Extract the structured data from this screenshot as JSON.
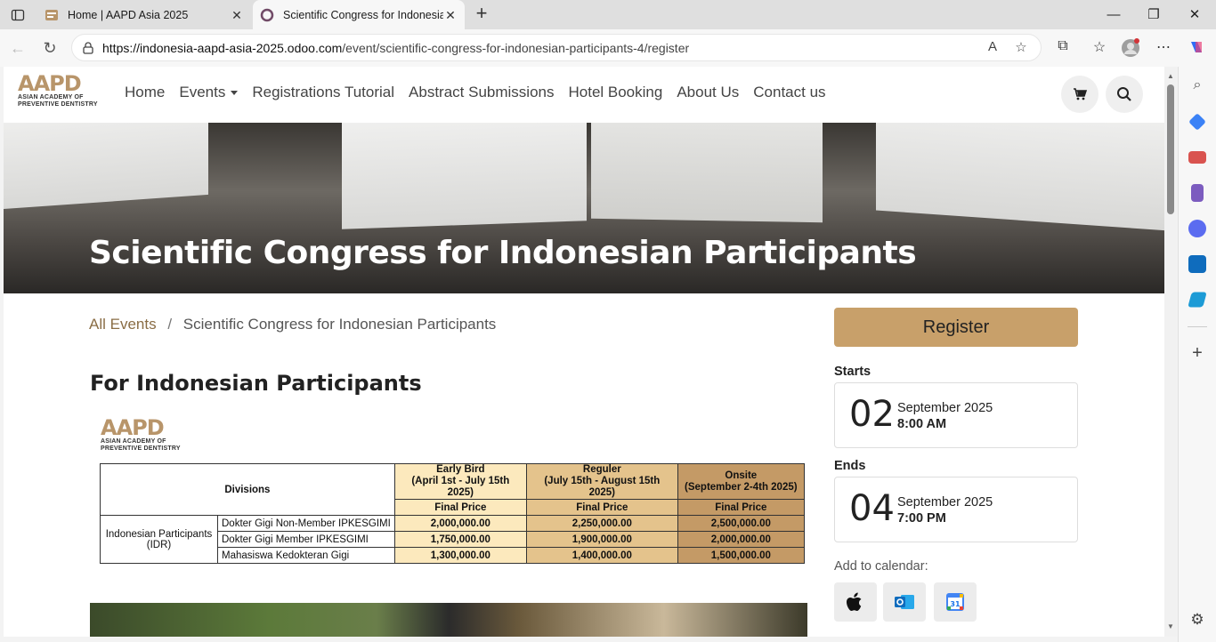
{
  "browser": {
    "tabs": [
      {
        "title": "Home | AAPD Asia 2025",
        "active": false
      },
      {
        "title": "Scientific Congress for Indonesian Participants",
        "active": true
      }
    ],
    "url_host": "https://indonesia-aapd-asia-2025.odoo.com",
    "url_path": "/event/scientific-congress-for-indonesian-participants-4/register"
  },
  "site": {
    "logo": {
      "mark": "AAPD",
      "line1": "ASIAN ACADEMY OF",
      "line2": "PREVENTIVE DENTISTRY"
    },
    "nav": [
      "Home",
      "Events",
      "Registrations Tutorial",
      "Abstract Submissions",
      "Hotel Booking",
      "About Us",
      "Contact us"
    ]
  },
  "hero": {
    "title": "Scientific Congress for Indonesian Participants"
  },
  "breadcrumb": {
    "root": "All Events",
    "separator": "/",
    "current": "Scientific Congress for Indonesian Participants"
  },
  "content": {
    "heading": "For Indonesian Participants",
    "table": {
      "divisions_header": "Divisions",
      "columns": [
        {
          "line1": "Early Bird",
          "line2": "(April 1st - July 15th 2025)",
          "sub": "Final Price",
          "color": "#fce9bd"
        },
        {
          "line1": "Reguler",
          "line2": "(July 15th - August 15th 2025)",
          "sub": "Final Price",
          "color": "#e4c38c"
        },
        {
          "line1": "Onsite",
          "line2": "(September 2-4th 2025)",
          "sub": "Final Price",
          "color": "#c49a66"
        }
      ],
      "group": {
        "line1": "Indonesian Participants",
        "line2": "(IDR)"
      },
      "rows": [
        {
          "label": "Dokter Gigi Non-Member IPKESGIMI",
          "prices": [
            "2,000,000.00",
            "2,250,000.00",
            "2,500,000.00"
          ]
        },
        {
          "label": "Dokter Gigi Member IPKESGIMI",
          "prices": [
            "1,750,000.00",
            "1,900,000.00",
            "2,000,000.00"
          ]
        },
        {
          "label": "Mahasiswa Kedokteran Gigi",
          "prices": [
            "1,300,000.00",
            "1,400,000.00",
            "1,500,000.00"
          ]
        }
      ]
    }
  },
  "sidebar": {
    "register_label": "Register",
    "starts": {
      "label": "Starts",
      "day": "02",
      "month": "September 2025",
      "time": "8:00 AM"
    },
    "ends": {
      "label": "Ends",
      "day": "04",
      "month": "September 2025",
      "time": "7:00 PM"
    },
    "calendar_label": "Add to calendar:",
    "calendar_icons": [
      "apple-icon",
      "outlook-icon",
      "google-calendar-icon"
    ]
  },
  "colors": {
    "accent": "#c8a06a",
    "link": "#8a6d45"
  }
}
